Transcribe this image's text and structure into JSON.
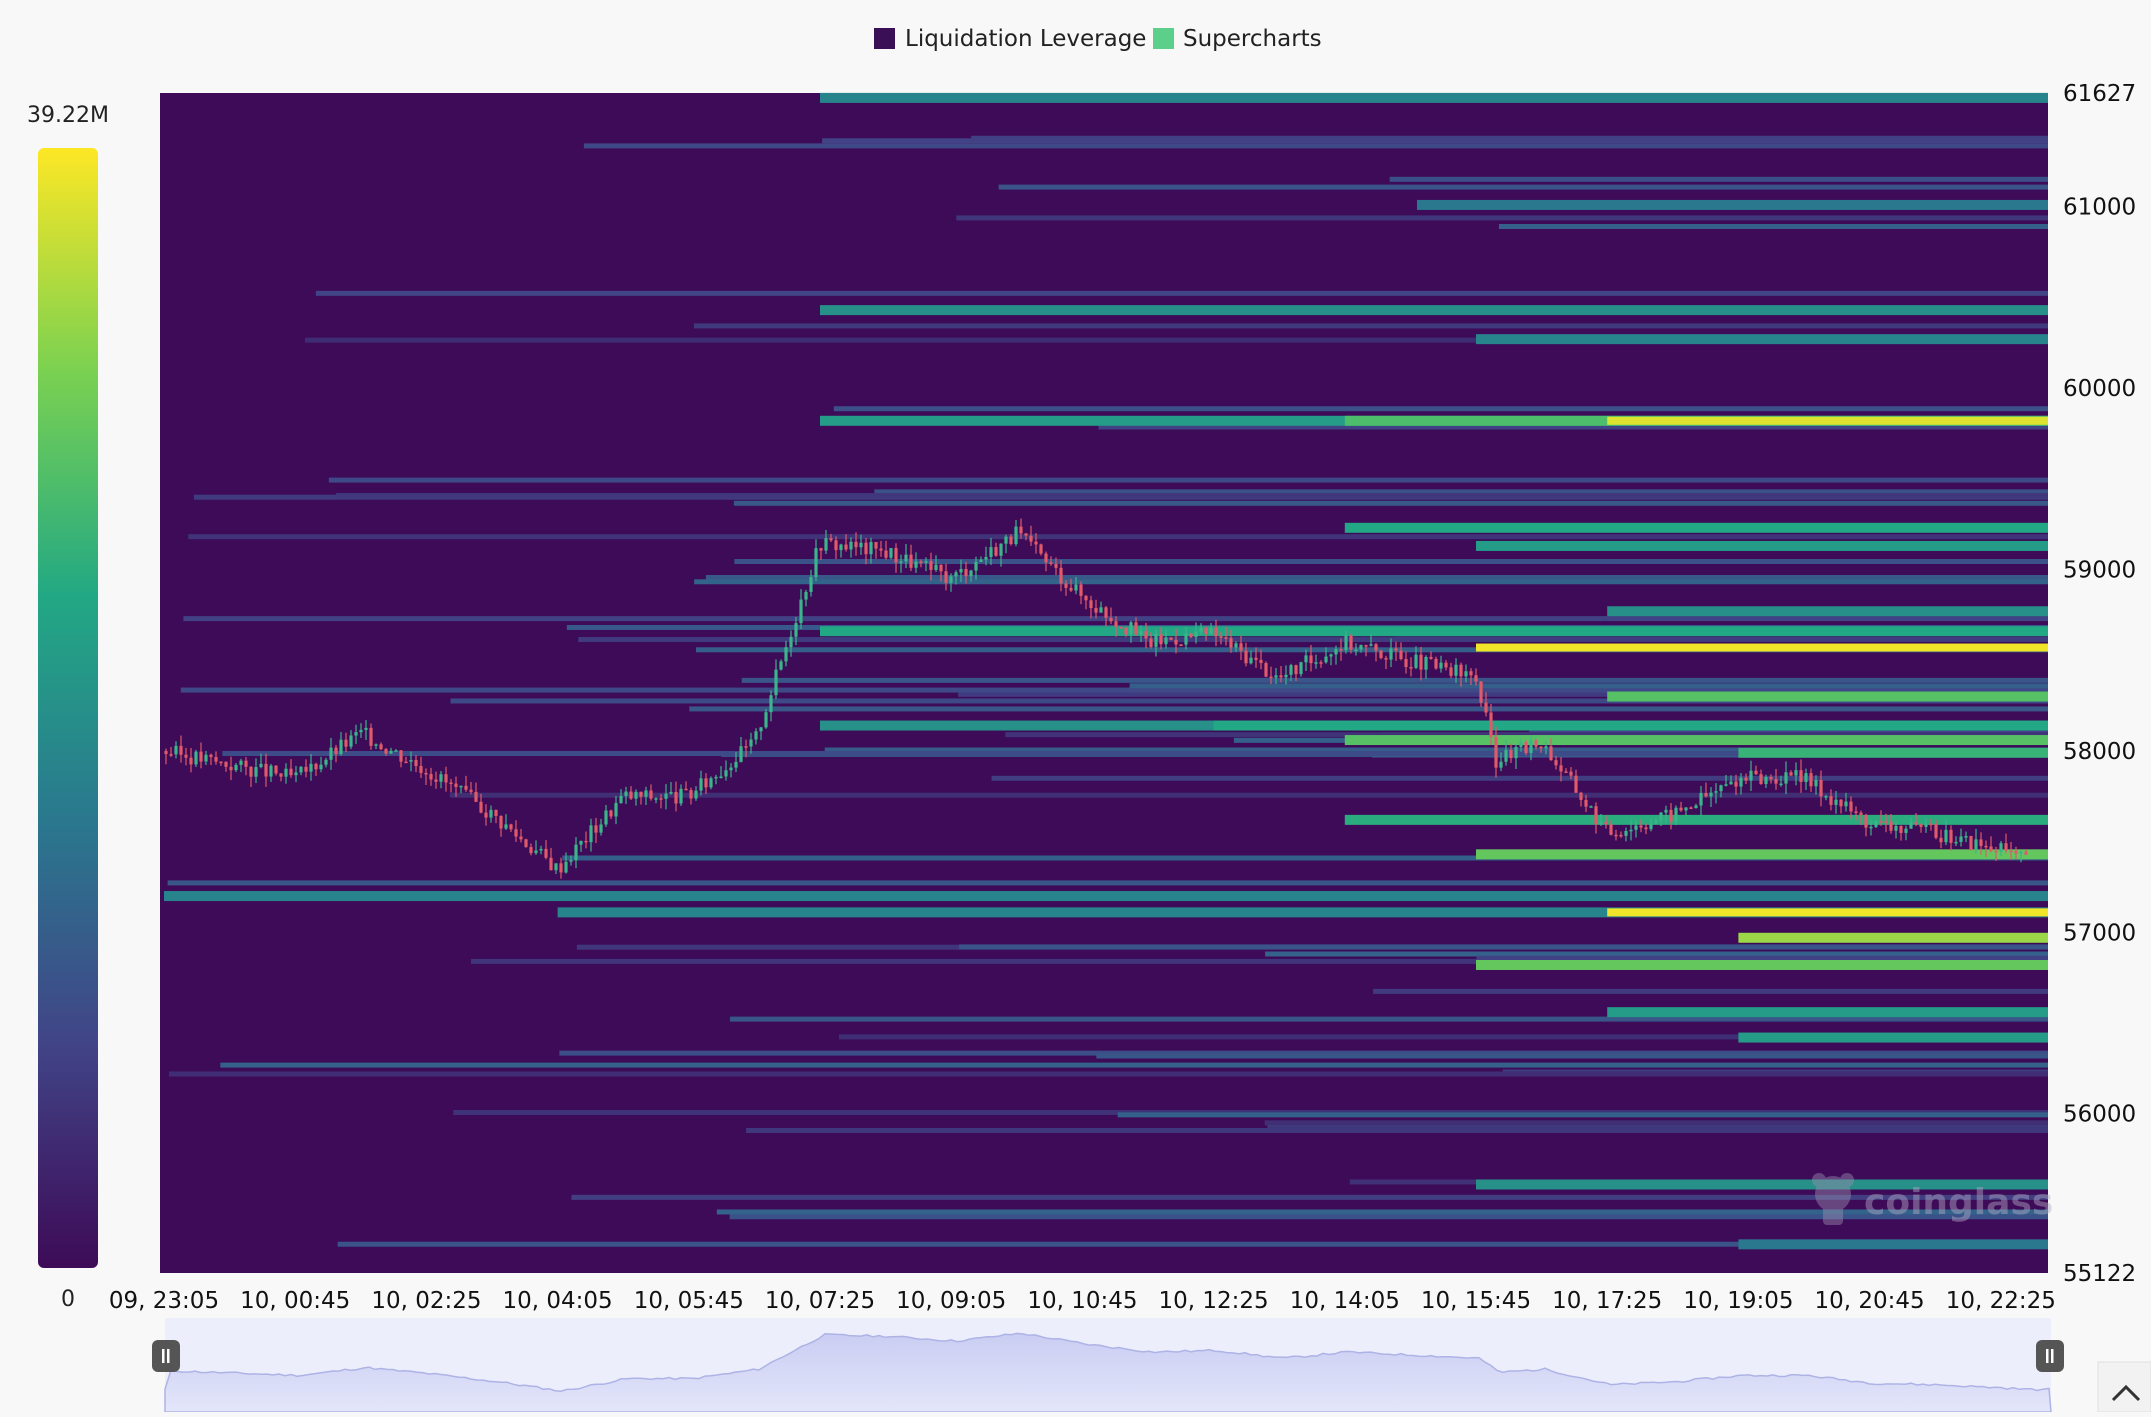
{
  "legend": {
    "items": [
      {
        "label": "Liquidation Leverage",
        "color": "#3a0f56"
      },
      {
        "label": "Supercharts",
        "color": "#5ccf8a"
      }
    ]
  },
  "colorbar": {
    "max_label": "39.22M",
    "min_label": "0",
    "max_value": 39220000,
    "min_value": 0
  },
  "watermark": "coinglass",
  "chart_data": {
    "type": "heatmap",
    "title": "",
    "xlabel": "",
    "ylabel": "",
    "x_ticks": [
      "09, 23:05",
      "10, 00:45",
      "10, 02:25",
      "10, 04:05",
      "10, 05:45",
      "10, 07:25",
      "10, 09:05",
      "10, 10:45",
      "10, 12:25",
      "10, 14:05",
      "10, 15:45",
      "10, 17:25",
      "10, 19:05",
      "10, 20:45",
      "10, 22:25"
    ],
    "y_ticks": [
      61627,
      61000,
      60000,
      59000,
      58000,
      57000,
      56000,
      55122
    ],
    "ylim": [
      55122,
      61627
    ],
    "colorscale": [
      "#3d0b57",
      "#414487",
      "#2a788e",
      "#22a884",
      "#7ad151",
      "#fde725"
    ],
    "liquidation_bands": [
      {
        "price": 61600,
        "start": "10, 07:25",
        "intensity": 0.45
      },
      {
        "price": 61010,
        "start": "10, 15:00",
        "intensity": 0.4
      },
      {
        "price": 60430,
        "start": "10, 07:25",
        "intensity": 0.5
      },
      {
        "price": 60270,
        "start": "10, 15:45",
        "intensity": 0.45
      },
      {
        "price": 59820,
        "start": "10, 07:25",
        "intensity": 0.55
      },
      {
        "price": 59820,
        "start": "10, 14:05",
        "intensity": 0.7
      },
      {
        "price": 59820,
        "start": "10, 17:25",
        "intensity": 0.95
      },
      {
        "price": 59230,
        "start": "10, 14:05",
        "intensity": 0.6
      },
      {
        "price": 59130,
        "start": "10, 15:45",
        "intensity": 0.55
      },
      {
        "price": 58770,
        "start": "10, 17:25",
        "intensity": 0.5
      },
      {
        "price": 58660,
        "start": "10, 07:25",
        "intensity": 0.6
      },
      {
        "price": 58570,
        "start": "10, 15:45",
        "intensity": 0.98
      },
      {
        "price": 58300,
        "start": "10, 17:25",
        "intensity": 0.72
      },
      {
        "price": 58140,
        "start": "10, 07:25",
        "intensity": 0.5
      },
      {
        "price": 58140,
        "start": "10, 12:25",
        "intensity": 0.6
      },
      {
        "price": 58060,
        "start": "10, 14:05",
        "intensity": 0.72
      },
      {
        "price": 57990,
        "start": "10, 19:05",
        "intensity": 0.65
      },
      {
        "price": 57620,
        "start": "10, 14:05",
        "intensity": 0.62
      },
      {
        "price": 57430,
        "start": "10, 15:45",
        "intensity": 0.75
      },
      {
        "price": 57200,
        "start": "09, 23:05",
        "intensity": 0.45
      },
      {
        "price": 57110,
        "start": "10, 04:05",
        "intensity": 0.45
      },
      {
        "price": 57110,
        "start": "10, 17:25",
        "intensity": 0.98
      },
      {
        "price": 56970,
        "start": "10, 19:05",
        "intensity": 0.85
      },
      {
        "price": 56820,
        "start": "10, 15:45",
        "intensity": 0.75
      },
      {
        "price": 56560,
        "start": "10, 17:25",
        "intensity": 0.55
      },
      {
        "price": 56420,
        "start": "10, 19:05",
        "intensity": 0.55
      },
      {
        "price": 55610,
        "start": "10, 15:45",
        "intensity": 0.5
      },
      {
        "price": 55280,
        "start": "10, 19:05",
        "intensity": 0.4
      }
    ],
    "price_path": [
      {
        "x": "09, 23:05",
        "price": 58000
      },
      {
        "x": "10, 00:45",
        "price": 57850
      },
      {
        "x": "10, 01:35",
        "price": 58100
      },
      {
        "x": "10, 02:25",
        "price": 57900
      },
      {
        "x": "10, 03:15",
        "price": 57650
      },
      {
        "x": "10, 04:05",
        "price": 57350
      },
      {
        "x": "10, 04:55",
        "price": 57750
      },
      {
        "x": "10, 05:45",
        "price": 57750
      },
      {
        "x": "10, 06:35",
        "price": 58050
      },
      {
        "x": "10, 07:00",
        "price": 58600
      },
      {
        "x": "10, 07:25",
        "price": 59150
      },
      {
        "x": "10, 08:15",
        "price": 59100
      },
      {
        "x": "10, 09:05",
        "price": 58950
      },
      {
        "x": "10, 09:55",
        "price": 59200
      },
      {
        "x": "10, 10:45",
        "price": 58850
      },
      {
        "x": "10, 11:35",
        "price": 58600
      },
      {
        "x": "10, 12:25",
        "price": 58650
      },
      {
        "x": "10, 13:15",
        "price": 58400
      },
      {
        "x": "10, 14:05",
        "price": 58600
      },
      {
        "x": "10, 14:55",
        "price": 58500
      },
      {
        "x": "10, 15:45",
        "price": 58400
      },
      {
        "x": "10, 16:00",
        "price": 57950
      },
      {
        "x": "10, 16:35",
        "price": 58050
      },
      {
        "x": "10, 17:25",
        "price": 57550
      },
      {
        "x": "10, 18:15",
        "price": 57650
      },
      {
        "x": "10, 19:05",
        "price": 57850
      },
      {
        "x": "10, 19:55",
        "price": 57850
      },
      {
        "x": "10, 20:45",
        "price": 57600
      },
      {
        "x": "10, 21:35",
        "price": 57550
      },
      {
        "x": "10, 22:25",
        "price": 57450
      },
      {
        "x": "10, 22:45",
        "price": 57400
      }
    ]
  },
  "ui": {
    "scroll_up_icon": "chevron-up-icon",
    "slider_handle_icon": "pause-handle-icon"
  }
}
